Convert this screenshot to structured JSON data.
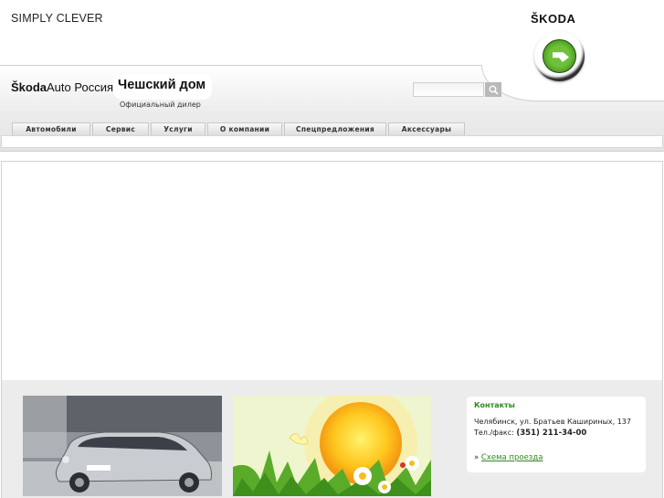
{
  "header": {
    "tagline": "SIMPLY CLEVER",
    "brand_word": "ŠKODA",
    "partner_logo_bold": "Škoda",
    "partner_logo_rest": "Auto Россия",
    "dealer_name": "Чешский дом",
    "dealer_subtitle": "Официальный дилер"
  },
  "search": {
    "placeholder": "",
    "button_icon": "search-icon"
  },
  "nav": {
    "tabs": [
      {
        "label": "Автомобили"
      },
      {
        "label": "Сервис"
      },
      {
        "label": "Услуги"
      },
      {
        "label": "О компании"
      },
      {
        "label": "Спецпредложения"
      },
      {
        "label": "Аксессуары"
      }
    ]
  },
  "contacts": {
    "title": "Контакты",
    "address": "Челябинск, ул. Братьев Кашириных, 137",
    "phone_label": "Тел./факс:",
    "phone": "(351) 211-34-00",
    "map_prefix": "»",
    "map_link": "Схема проезда"
  },
  "colors": {
    "accent_green": "#2f8a1f",
    "logo_green": "#4a9a22"
  }
}
